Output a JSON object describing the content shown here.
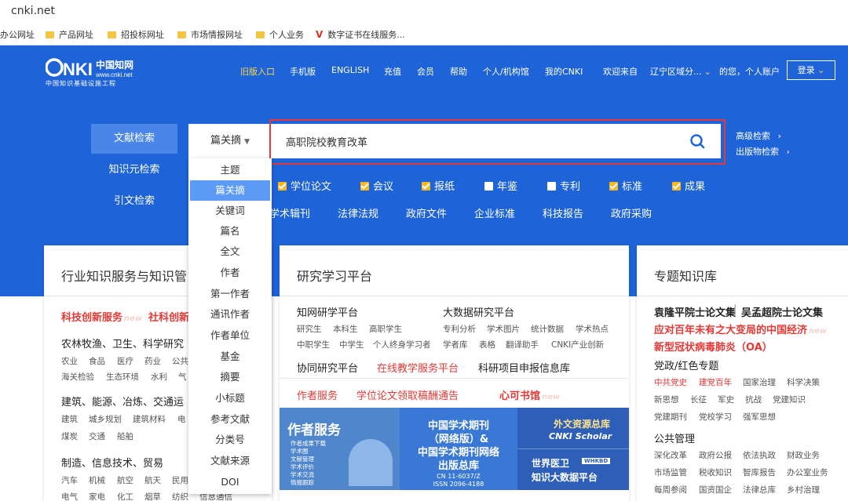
{
  "browser": {
    "url": "cnki.net",
    "bookmarks": [
      {
        "label": "办公网址",
        "icon": "none"
      },
      {
        "label": "产品网址",
        "icon": "folder-icon"
      },
      {
        "label": "招投标网址",
        "icon": "folder-icon"
      },
      {
        "label": "市场情报网址",
        "icon": "folder-icon"
      },
      {
        "label": "个人业务",
        "icon": "folder-icon"
      },
      {
        "label": "数字证书在线服务...",
        "icon": "v-logo-icon"
      }
    ]
  },
  "header": {
    "logo_sub": "中国知识基础设施工程",
    "nav": [
      "旧版入口",
      "手机版",
      "ENGLISH",
      "充值",
      "会员",
      "帮助",
      "个人/机构馆",
      "我的CNKI"
    ],
    "welcome": "欢迎来自",
    "region": "辽宁区域分...",
    "greeting": "的您，个人账户",
    "login": "登录"
  },
  "left_tabs": [
    "文献检索",
    "知识元检索",
    "引文检索"
  ],
  "search": {
    "scope": "篇关摘",
    "value": "高职院校教育改革",
    "advanced": "高级检索",
    "publication": "出版物检索"
  },
  "dropdown": [
    "主题",
    "篇关摘",
    "关键词",
    "篇名",
    "全文",
    "作者",
    "第一作者",
    "通讯作者",
    "作者单位",
    "基金",
    "摘要",
    "小标题",
    "参考文献",
    "分类号",
    "文献来源",
    "DOI"
  ],
  "checkboxes": [
    {
      "label": "学位论文",
      "checked": true
    },
    {
      "label": "会议",
      "checked": true
    },
    {
      "label": "报纸",
      "checked": true
    },
    {
      "label": "年鉴",
      "checked": false
    },
    {
      "label": "专利",
      "checked": false
    },
    {
      "label": "标准",
      "checked": true
    },
    {
      "label": "成果",
      "checked": true
    }
  ],
  "subtypes": [
    "学术辑刊",
    "法律法规",
    "政府文件",
    "企业标准",
    "科技报告",
    "政府采购"
  ],
  "card1": {
    "title": "行业知识服务与知识管",
    "services": [
      "科技创新服务",
      "社科创新"
    ],
    "new_tag": "new",
    "group1_title": "农林牧渔、卫生、科学研究",
    "group1_line1": [
      "农业",
      "食品",
      "医疗",
      "药业",
      "公共"
    ],
    "group1_line2": [
      "海关检验",
      "生态环境",
      "水利",
      "气"
    ],
    "group2_title": "建筑、能源、冶炼、交通运",
    "group2_line1": [
      "建筑",
      "城乡规划",
      "建筑材料",
      "电"
    ],
    "group2_line2": [
      "煤炭",
      "交通",
      "船舶"
    ],
    "group3_title": "制造、信息技术、贸易",
    "group3_line1": [
      "汽车",
      "机械",
      "航空",
      "航天",
      "民用"
    ],
    "group3_line2": [
      "电气",
      "家电",
      "化工",
      "烟草",
      "纺织",
      "信息通信"
    ]
  },
  "card2": {
    "title": "研究学习平台",
    "p1": "知网研学平台",
    "p1_items": [
      "研究生",
      "本科生",
      "高职学生",
      "中职学生",
      "中学生",
      "个人终身学习者"
    ],
    "p2": "大数据研究平台",
    "p2_items": [
      "专利分析",
      "学术图片",
      "统计数据",
      "学术热点",
      "学者库",
      "表格",
      "翻译助手",
      "CNKI产业创新"
    ],
    "row3": [
      "协同研究平台",
      "在线教学服务平台",
      "科研项目申报信息库"
    ],
    "row4": [
      "作者服务",
      "学位论文领取稿酬通告",
      "心可书馆"
    ],
    "new_tag": "new",
    "banner1_title": "作者服务",
    "banner1_items": [
      "作者成果下载",
      "学术圈",
      "文献管理",
      "学术评价",
      "学术交流",
      "情报跟踪"
    ],
    "banner2_lines": [
      "中国学术期刊",
      "（网络版）&",
      "中国学术期刊网络",
      "出版总库"
    ],
    "banner2_codes": [
      "CN 11-6037/Z",
      "ISSN 2096-4188"
    ],
    "banner3_top": "外文资源总库",
    "banner3_top_sub": "CNKI Scholar",
    "banner3_bottom": "世界医卫",
    "banner3_badge": "WHKBD",
    "banner3_bottom_sub": "知识大数据平台"
  },
  "card3": {
    "title": "专题知识库",
    "line1": [
      "袁隆平院士论文集",
      "吴孟超院士论文集"
    ],
    "line2": "应对百年未有之大变局的中国经济",
    "line3": "新型冠状病毒肺炎（OA）",
    "new_tag": "new",
    "sec1": "党政/红色专题",
    "sec1_row1": [
      "中共党史",
      "建党百年",
      "国家治理",
      "科学决策"
    ],
    "sec1_row2": [
      "新思想",
      "长征",
      "军史",
      "抗战",
      "党建知识"
    ],
    "sec1_row3": [
      "党建期刊",
      "党校学习",
      "强军思想"
    ],
    "sec2": "公共管理",
    "sec2_row1": [
      "深化改革",
      "政府公报",
      "依法执政",
      "财政业务"
    ],
    "sec2_row2": [
      "市场监管",
      "税收知识",
      "智库报告",
      "办公室业务"
    ],
    "sec2_row3": [
      "每周参阅",
      "国资国企",
      "法律总库",
      "乡村治理"
    ]
  },
  "colors": {
    "brand_blue": "#1e64d8",
    "accent_red": "#e53935",
    "check_yellow": "#f5b820"
  }
}
